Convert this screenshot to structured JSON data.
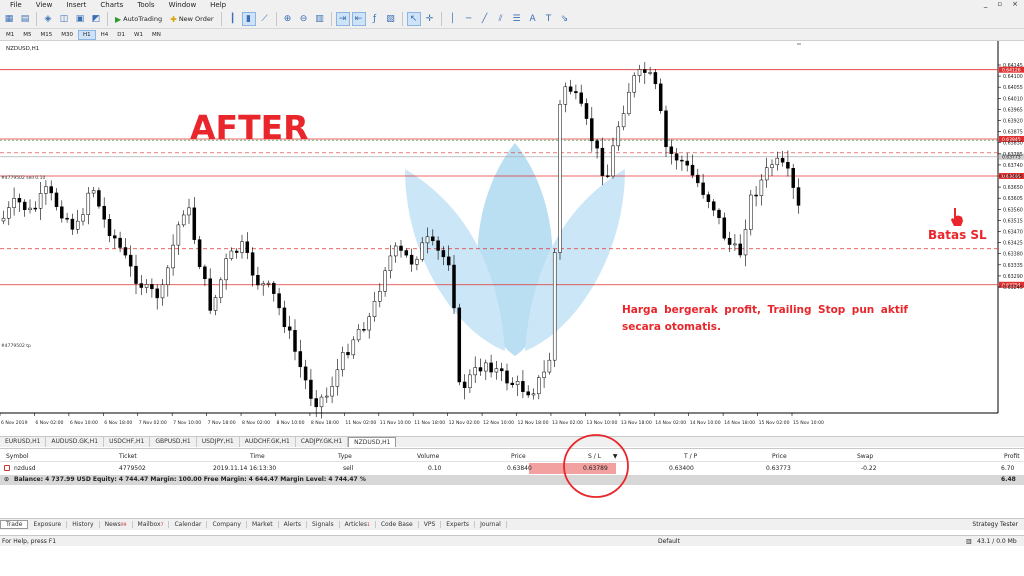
{
  "menu": {
    "items": [
      "File",
      "View",
      "Insert",
      "Charts",
      "Tools",
      "Window",
      "Help"
    ],
    "window_controls": [
      "_",
      "▫",
      "×"
    ]
  },
  "toolbar": {
    "autotrading_label": "AutoTrading",
    "new_order_label": "New Order"
  },
  "timeframes": [
    "M1",
    "M5",
    "M15",
    "M30",
    "H1",
    "H4",
    "D1",
    "W1",
    "MN"
  ],
  "timeframe_active": "H1",
  "chart": {
    "title": "NZDUSD,H1",
    "price_labels": [
      "0.64145",
      "0.64100",
      "0.64055",
      "0.64010",
      "0.63965",
      "0.63920",
      "0.63875",
      "0.63830",
      "0.63785",
      "0.63740",
      "0.63695",
      "0.63650",
      "0.63605",
      "0.63560",
      "0.63515",
      "0.63470",
      "0.63425",
      "0.63380",
      "0.63335",
      "0.63290",
      "0.63245"
    ],
    "level_labels": {
      "top_red": "0.64126",
      "sl": "0.63845",
      "bid": "0.63773",
      "mid_red": "0.63695",
      "bottom_red": "0.63254"
    },
    "order_label_sl": "#4779502 sell 0.10",
    "order_label_tp": "#4779502 tp",
    "time_labels": [
      "6 Nov 2019",
      "6 Nov 02:00",
      "6 Nov 10:00",
      "6 Nov 18:00",
      "7 Nov 02:00",
      "7 Nov 10:00",
      "7 Nov 18:00",
      "8 Nov 02:00",
      "8 Nov 10:00",
      "8 Nov 18:00",
      "11 Nov 02:00",
      "11 Nov 10:00",
      "11 Nov 18:00",
      "12 Nov 02:00",
      "12 Nov 10:00",
      "12 Nov 18:00",
      "13 Nov 02:00",
      "13 Nov 10:00",
      "13 Nov 18:00",
      "14 Nov 02:00",
      "14 Nov 10:00",
      "14 Nov 18:00",
      "15 Nov 02:00",
      "15 Nov 10:00"
    ]
  },
  "symbol_tabs": [
    "EURUSD,H1",
    "AUDUSD.GK,H1",
    "USDCHF,H1",
    "GBPUSD,H1",
    "USDJPY,H1",
    "AUDCHF.GK,H1",
    "CADJPY.GK,H1",
    "NZDUSD,H1"
  ],
  "symbol_tab_active": "NZDUSD,H1",
  "terminal": {
    "headers": {
      "symbol": "Symbol",
      "ticket": "Ticket",
      "time": "Time",
      "type": "Type",
      "volume": "Volume",
      "price": "Price",
      "sl": "S / L",
      "tp": "T / P",
      "price_now": "Price",
      "swap": "Swap",
      "profit": "Profit"
    },
    "row": {
      "symbol": "nzdusd",
      "ticket": "4779502",
      "time": "2019.11.14 16:13:30",
      "type": "sell",
      "volume": "0.10",
      "price": "0.63840",
      "sl": "0.63789",
      "tp": "0.63400",
      "price_now": "0.63773",
      "swap": "-0.22",
      "profit": "6.70"
    },
    "balance_text": "Balance: 4 737.99 USD  Equity: 4 744.47  Margin: 100.00  Free Margin: 4 644.47  Margin Level: 4 744.47 %",
    "balance_profit": "6.48"
  },
  "bottom_tabs": [
    {
      "label": "Trade",
      "badge": ""
    },
    {
      "label": "Exposure",
      "badge": ""
    },
    {
      "label": "History",
      "badge": ""
    },
    {
      "label": "News",
      "badge": "99"
    },
    {
      "label": "Mailbox",
      "badge": "7"
    },
    {
      "label": "Calendar",
      "badge": ""
    },
    {
      "label": "Company",
      "badge": ""
    },
    {
      "label": "Market",
      "badge": ""
    },
    {
      "label": "Alerts",
      "badge": ""
    },
    {
      "label": "Signals",
      "badge": ""
    },
    {
      "label": "Articles",
      "badge": "1"
    },
    {
      "label": "Code Base",
      "badge": ""
    },
    {
      "label": "VPS",
      "badge": ""
    },
    {
      "label": "Experts",
      "badge": ""
    },
    {
      "label": "Journal",
      "badge": ""
    }
  ],
  "bottom_tab_active": "Trade",
  "strategy_tester_label": "Strategy Tester",
  "status": {
    "help": "For Help, press F1",
    "profile": "Default",
    "traffic": "43.1 / 0.0 Mb"
  },
  "annotations": {
    "after": "AFTER",
    "batas_sl": "Batas SL",
    "note": "Harga bergerak profit, Trailing Stop pun aktif secara otomatis."
  },
  "colors": {
    "annotation_red": "#e8262b",
    "level_red": "#e03030",
    "sl_highlight": "#f2a0a0",
    "watermark_blue": "#a9d7f0"
  }
}
